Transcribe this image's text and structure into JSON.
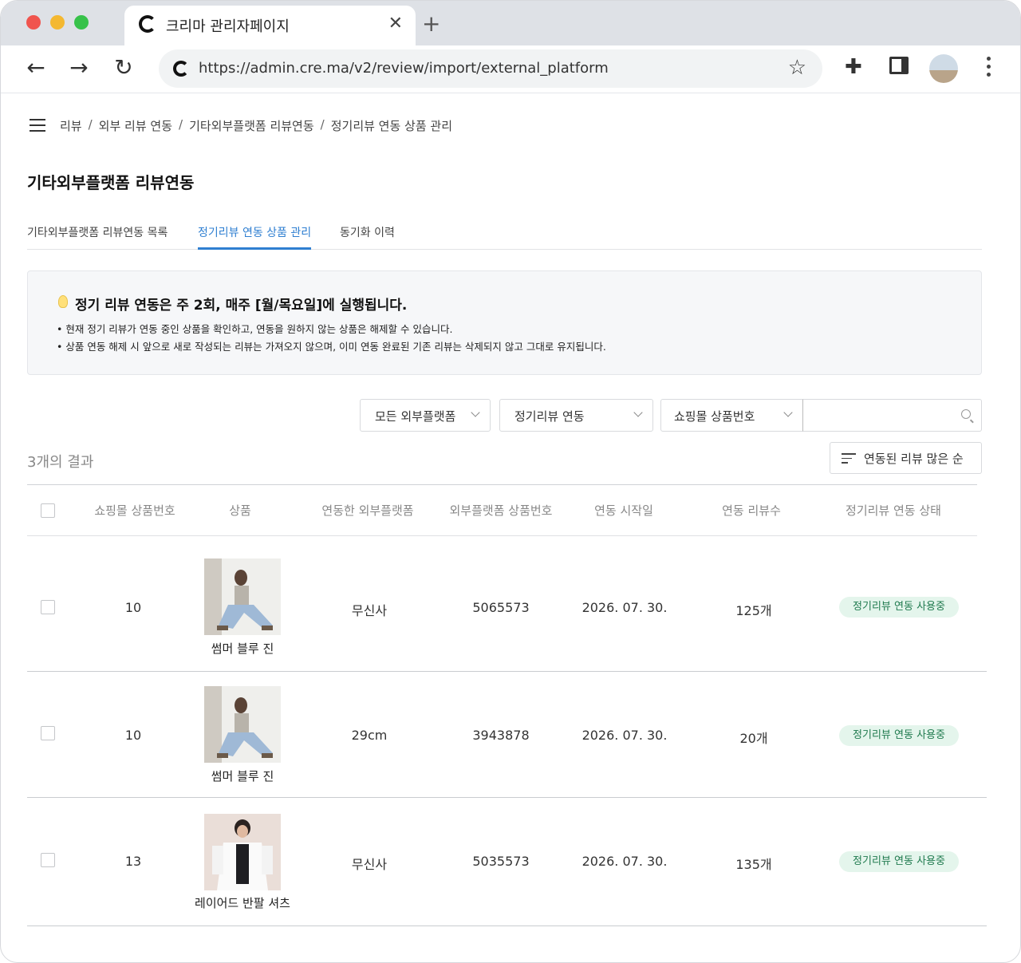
{
  "browser": {
    "tab_title": "크리마 관리자페이지",
    "url": "https://admin.cre.ma/v2/review/import/external_platform"
  },
  "breadcrumb": [
    "리뷰",
    "외부 리뷰 연동",
    "기타외부플랫폼 리뷰연동",
    "정기리뷰 연동 상품 관리"
  ],
  "page_title": "기타외부플랫폼 리뷰연동",
  "tabs": [
    {
      "label": "기타외부플랫폼 리뷰연동 목록",
      "active": false
    },
    {
      "label": "정기리뷰 연동 상품 관리",
      "active": true
    },
    {
      "label": "동기화 이력",
      "active": false
    }
  ],
  "notice": {
    "title": "정기 리뷰 연동은 주 2회, 매주 [월/목요일]에 실행됩니다.",
    "lines": [
      "• 현재 정기 리뷰가 연동 중인 상품을 확인하고, 연동을 원하지 않는 상품은 해제할 수 있습니다.",
      "• 상품 연동 해제 시 앞으로 새로 작성되는 리뷰는 가져오지 않으며, 이미 연동 완료된 기존 리뷰는 삭제되지 않고 그대로 유지됩니다."
    ]
  },
  "filters": {
    "platform": "모든 외부플랫폼",
    "sync_type": "정기리뷰 연동",
    "search_field": "쇼핑몰 상품번호",
    "search_value": ""
  },
  "result_count": "3개의 결과",
  "sort_label": "연동된 리뷰 많은 순",
  "table": {
    "headers": [
      "쇼핑몰 상품번호",
      "상품",
      "연동한 외부플랫폼",
      "외부플랫폼 상품번호",
      "연동 시작일",
      "연동 리뷰수",
      "정기리뷰 연동 상태"
    ],
    "rows": [
      {
        "product_no": "10",
        "product_name": "썸머 블루 진",
        "platform": "무신사",
        "external_no": "5065573",
        "start_date": "2026. 07. 30.",
        "review_count": "125개",
        "status": "정기리뷰 연동 사용중"
      },
      {
        "product_no": "10",
        "product_name": "썸머 블루 진",
        "platform": "29cm",
        "external_no": "3943878",
        "start_date": "2026. 07. 30.",
        "review_count": "20개",
        "status": "정기리뷰 연동 사용중"
      },
      {
        "product_no": "13",
        "product_name": "레이어드 반팔 셔츠",
        "platform": "무신사",
        "external_no": "5035573",
        "start_date": "2026. 07. 30.",
        "review_count": "135개",
        "status": "정기리뷰 연동 사용중"
      }
    ]
  },
  "icons": [
    "back-icon",
    "forward-icon",
    "reload-icon",
    "star-icon",
    "extensions-icon",
    "sidepanel-icon",
    "search-icon",
    "sort-icon",
    "menu-icon",
    "bulb-icon"
  ]
}
